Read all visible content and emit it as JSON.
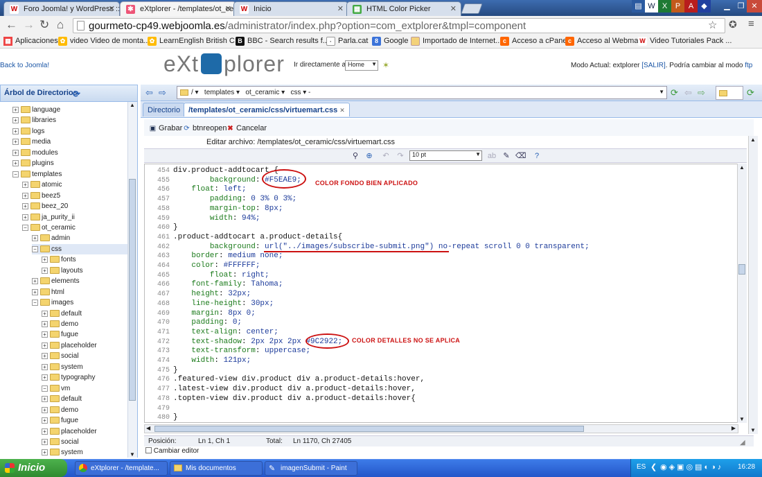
{
  "browser": {
    "tabs": [
      {
        "label": "Foro Joomla! y WordPress ::",
        "icon": "joomla-forum-icon"
      },
      {
        "label": "eXtplorer - /templates/ot_ce",
        "icon": "joomla-icon"
      },
      {
        "label": "Inicio",
        "icon": "webjoomla-icon"
      },
      {
        "label": "HTML Color Picker",
        "icon": "color-picker-icon"
      }
    ],
    "url_host": "gourmeto-cp49.webjoomla.es",
    "url_path": "/administrator/index.php?option=com_extplorer&tmpl=component",
    "bookmarks": [
      "Aplicaciones",
      "video Video de monta...",
      "LearnEnglish  British C...",
      "BBC - Search results f...",
      "Parla.cat",
      "Google",
      "Importado de Internet...",
      "Acceso a cPanel",
      "Acceso al Webmail",
      "Video Tutoriales Pack ..."
    ]
  },
  "header": {
    "back_link": "Back to Joomla!",
    "logo_a": "eXt",
    "logo_b": "plorer",
    "goto_label": "Ir directamente a:",
    "goto_value": "Home",
    "mode_text": "Modo Actual: extplorer ",
    "mode_logout": "[SALIR]",
    "mode_text2": ". Podría cambiar al modo ",
    "mode_ftp": "ftp"
  },
  "tree": {
    "title": "Árbol de Directorios",
    "nodes": [
      {
        "label": "language",
        "level": 0,
        "open": false
      },
      {
        "label": "libraries",
        "level": 0,
        "open": false
      },
      {
        "label": "logs",
        "level": 0,
        "open": false
      },
      {
        "label": "media",
        "level": 0,
        "open": false
      },
      {
        "label": "modules",
        "level": 0,
        "open": false
      },
      {
        "label": "plugins",
        "level": 0,
        "open": false
      },
      {
        "label": "templates",
        "level": 0,
        "open": true
      },
      {
        "label": "atomic",
        "level": 1,
        "open": false
      },
      {
        "label": "beez5",
        "level": 1,
        "open": false
      },
      {
        "label": "beez_20",
        "level": 1,
        "open": false
      },
      {
        "label": "ja_purity_ii",
        "level": 1,
        "open": false
      },
      {
        "label": "ot_ceramic",
        "level": 1,
        "open": true
      },
      {
        "label": "admin",
        "level": 2,
        "open": false
      },
      {
        "label": "css",
        "level": 2,
        "open": true,
        "selected": true
      },
      {
        "label": "fonts",
        "level": 3,
        "open": false
      },
      {
        "label": "layouts",
        "level": 3,
        "open": false
      },
      {
        "label": "elements",
        "level": 2,
        "open": false
      },
      {
        "label": "html",
        "level": 2,
        "open": false
      },
      {
        "label": "images",
        "level": 2,
        "open": true
      },
      {
        "label": "default",
        "level": 3,
        "open": false
      },
      {
        "label": "demo",
        "level": 3,
        "open": false
      },
      {
        "label": "fugue",
        "level": 3,
        "open": false
      },
      {
        "label": "placeholder",
        "level": 3,
        "open": false
      },
      {
        "label": "social",
        "level": 3,
        "open": false
      },
      {
        "label": "system",
        "level": 3,
        "open": false
      },
      {
        "label": "typography",
        "level": 3,
        "open": false
      },
      {
        "label": "vm",
        "level": 3,
        "open": true
      },
      {
        "label": "default",
        "level": 3,
        "open": false
      },
      {
        "label": "demo",
        "level": 3,
        "open": false
      },
      {
        "label": "fugue",
        "level": 3,
        "open": false
      },
      {
        "label": "placeholder",
        "level": 3,
        "open": false
      },
      {
        "label": "social",
        "level": 3,
        "open": false
      },
      {
        "label": "system",
        "level": 3,
        "open": false
      }
    ]
  },
  "pathbar": {
    "crumbs": [
      "/",
      "templates",
      "ot_ceramic",
      "css",
      "-"
    ]
  },
  "tabs": {
    "directory": "Directorio",
    "file": "/templates/ot_ceramic/css/virtuemart.css"
  },
  "edit_toolbar": {
    "save": "Grabar",
    "reopen": "btnreopen",
    "cancel": "Cancelar",
    "editing_label": "Editar archivo: /templates/ot_ceramic/css/virtuemart.css",
    "font_size": "10 pt"
  },
  "code_lines": [
    {
      "n": "454",
      "t": "div.product-addtocart {"
    },
    {
      "n": "455",
      "t": "        background: #F5EAE9;"
    },
    {
      "n": "456",
      "t": "    float: left;"
    },
    {
      "n": "457",
      "t": "        padding: 0 3% 0 3%;"
    },
    {
      "n": "458",
      "t": "        margin-top: 8px;"
    },
    {
      "n": "459",
      "t": "        width: 94%;"
    },
    {
      "n": "460",
      "t": "}"
    },
    {
      "n": "461",
      "t": ".product-addtocart a.product-details{"
    },
    {
      "n": "462",
      "t": "        background: url(\"../images/subscribe-submit.png\") no-repeat scroll 0 0 transparent;"
    },
    {
      "n": "463",
      "t": "    border: medium none;"
    },
    {
      "n": "464",
      "t": "    color: #FFFFFF;"
    },
    {
      "n": "465",
      "t": "        float: right;"
    },
    {
      "n": "466",
      "t": "    font-family: Tahoma;"
    },
    {
      "n": "467",
      "t": "    height: 32px;"
    },
    {
      "n": "468",
      "t": "    line-height: 30px;"
    },
    {
      "n": "469",
      "t": "    margin: 8px 0;"
    },
    {
      "n": "470",
      "t": "    padding: 0;"
    },
    {
      "n": "471",
      "t": "    text-align: center;"
    },
    {
      "n": "472",
      "t": "    text-shadow: 2px 2px 2px #9C2922;"
    },
    {
      "n": "473",
      "t": "    text-transform: uppercase;"
    },
    {
      "n": "474",
      "t": "    width: 121px;"
    },
    {
      "n": "475",
      "t": "}"
    },
    {
      "n": "476",
      "t": ".featured-view div.product div a.product-details:hover,"
    },
    {
      "n": "477",
      "t": ".latest-view div.product div a.product-details:hover,"
    },
    {
      "n": "478",
      "t": ".topten-view div.product div a.product-details:hover{"
    },
    {
      "n": "479",
      "t": ""
    },
    {
      "n": "480",
      "t": "}"
    }
  ],
  "annotations": {
    "note1": "COLOR FONDO BIEN APLICADO",
    "note2": "COLOR DETALLES NO SE APLICA",
    "color": "#cc1111"
  },
  "status": {
    "pos_label": "Posición:",
    "pos_value": "Ln 1, Ch 1",
    "total_label": "Total:",
    "total_value": "Ln 1170, Ch 27405",
    "change_editor": "Cambiar editor"
  },
  "taskbar": {
    "start": "Inicio",
    "tasks": [
      "eXtplorer - /template...",
      "Mis documentos",
      "imagenSubmit - Paint"
    ],
    "lang": "ES",
    "clock": "16:28"
  }
}
